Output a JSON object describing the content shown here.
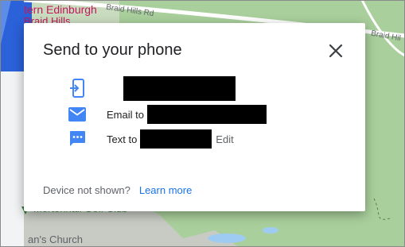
{
  "map": {
    "labels": {
      "edinburgh": "tern Edinburgh",
      "braid_hills": "Braid Hills",
      "braid_hills_rd": "Braid Hills Rd",
      "braid_hil": "Braid Hil",
      "golf_club": "Mortonhall Golf Club",
      "church": "an's Church"
    },
    "colors": {
      "land": "#c7cbc3",
      "park": "#a9cf9c",
      "water": "#9ecbf2",
      "road": "#ffffff",
      "accent_blue": "#1a56db"
    }
  },
  "dialog": {
    "title": "Send to your phone",
    "close_icon": "close-icon",
    "rows": {
      "device": {
        "icon": "send-to-device-icon"
      },
      "email": {
        "icon": "email-icon",
        "label": "Email to"
      },
      "text": {
        "icon": "sms-icon",
        "label": "Text to",
        "edit_label": "Edit"
      }
    },
    "footer": {
      "device_not_shown": "Device not shown?",
      "learn_more": "Learn more"
    },
    "colors": {
      "icon_blue": "#4285f4",
      "link_blue": "#1a73e8"
    }
  }
}
